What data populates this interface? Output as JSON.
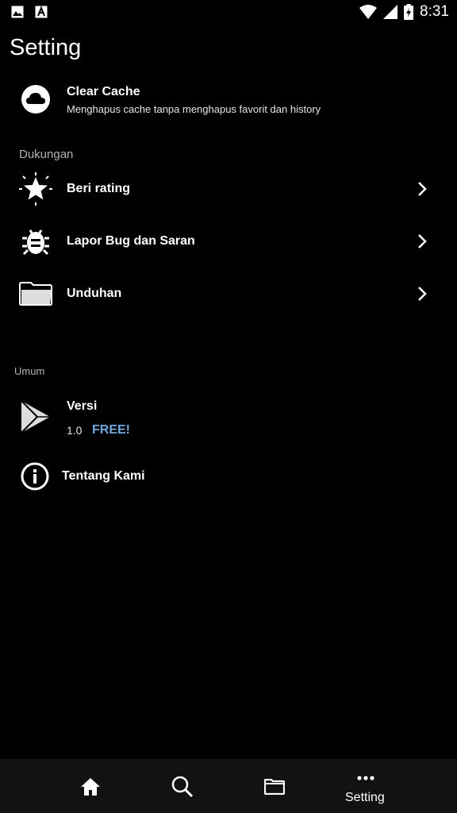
{
  "status_bar": {
    "time": "8:31",
    "icons": [
      "image-icon",
      "font-icon",
      "wifi-icon",
      "signal-icon",
      "battery-charging-icon"
    ]
  },
  "page": {
    "title": "Setting"
  },
  "cache": {
    "label": "Clear Cache",
    "description": "Menghapus cache tanpa menghapus favorit dan history",
    "icon": "cloud-icon"
  },
  "support": {
    "header": "Dukungan",
    "items": [
      {
        "label": "Beri rating",
        "icon": "star-icon"
      },
      {
        "label": "Lapor Bug dan Saran",
        "icon": "bug-icon"
      },
      {
        "label": "Unduhan",
        "icon": "folder-icon"
      }
    ]
  },
  "general": {
    "header": "Umum",
    "version": {
      "label": "Versi",
      "number": "1.0",
      "badge": "FREE!",
      "icon": "play-icon"
    },
    "about": {
      "label": "Tentang Kami",
      "icon": "info-icon"
    }
  },
  "bottom_nav": {
    "items": [
      {
        "icon": "home-icon",
        "label": ""
      },
      {
        "icon": "search-icon",
        "label": ""
      },
      {
        "icon": "folder-icon",
        "label": ""
      },
      {
        "icon": "more-icon",
        "label": "Setting"
      }
    ]
  },
  "colors": {
    "background": "#000000",
    "accent": "#6fa8dc",
    "nav_background": "#121212"
  }
}
